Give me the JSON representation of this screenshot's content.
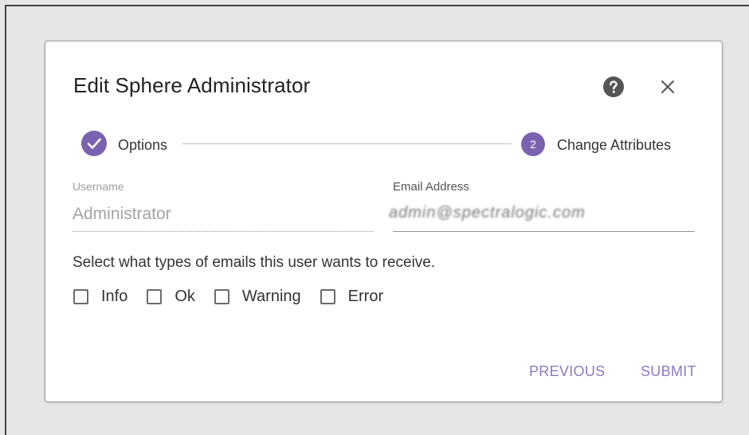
{
  "dialog": {
    "title": "Edit Sphere Administrator",
    "help_icon": "help-circle-icon",
    "close_icon": "close-icon"
  },
  "stepper": {
    "steps": [
      {
        "label": "Options",
        "state": "completed",
        "icon": "check-circle-icon"
      },
      {
        "label": "Change Attributes",
        "state": "active",
        "number": "2"
      }
    ]
  },
  "form": {
    "username": {
      "label": "Username",
      "value": "Administrator"
    },
    "email": {
      "label": "Email Address",
      "value": "admin@spectralogic.com"
    },
    "email_prefs_text": "Select what types of emails this user wants to receive.",
    "email_types": [
      {
        "label": "Info",
        "checked": false
      },
      {
        "label": "Ok",
        "checked": false
      },
      {
        "label": "Warning",
        "checked": false
      },
      {
        "label": "Error",
        "checked": false
      }
    ]
  },
  "actions": {
    "previous_label": "PREVIOUS",
    "submit_label": "SUBMIT"
  },
  "colors": {
    "accent": "#7b62b0",
    "button_text": "#8b7bc0",
    "backdrop": "#e6e6e6"
  }
}
